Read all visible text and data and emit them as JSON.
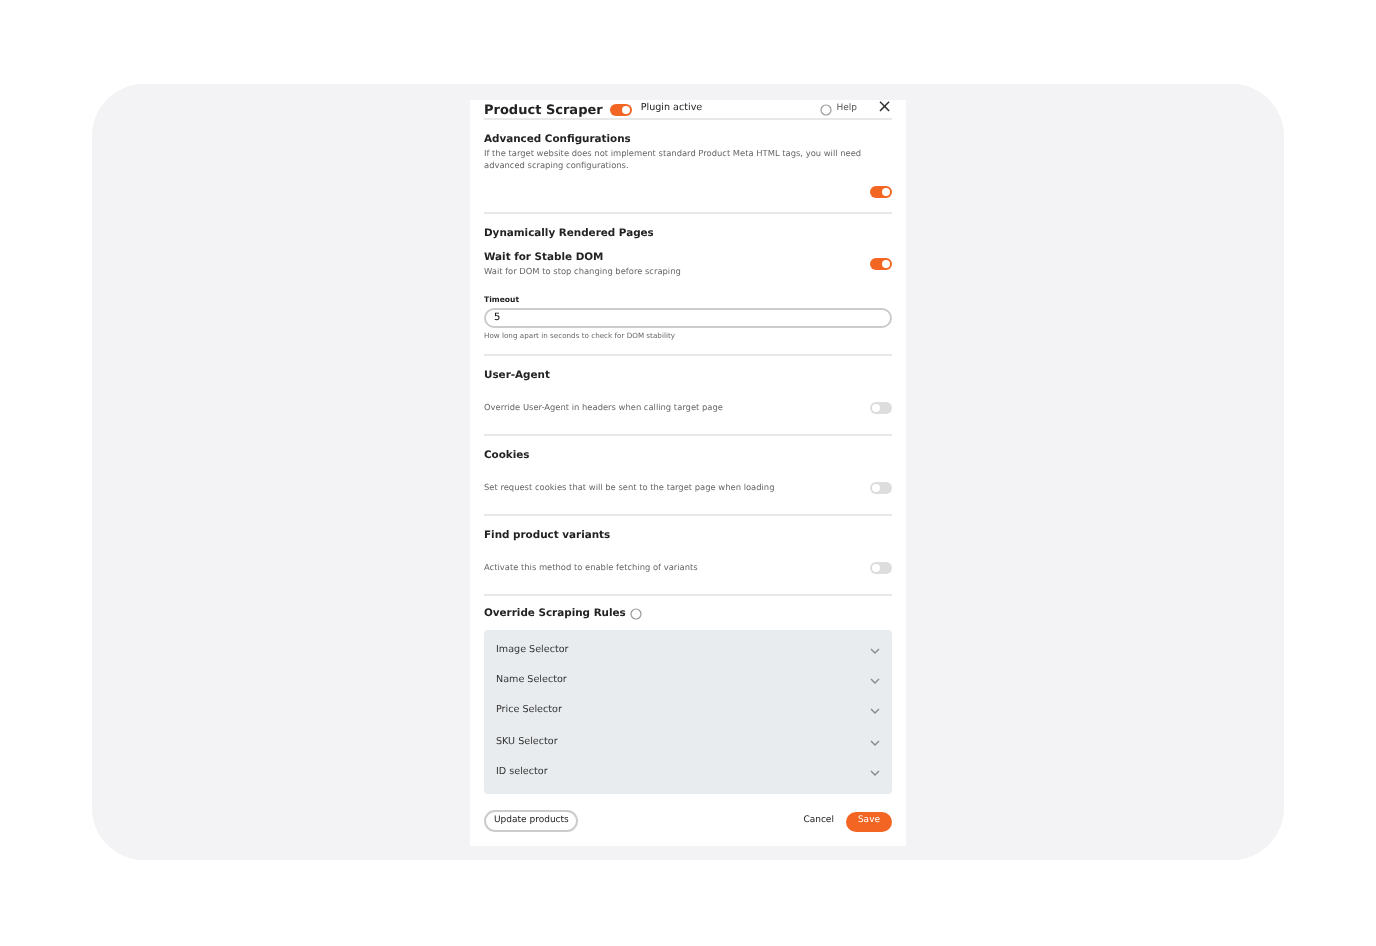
{
  "header": {
    "title": "Product Scraper",
    "plugin_toggle": {
      "on": true,
      "label": "Plugin active"
    },
    "help": "Help",
    "close": "×"
  },
  "advanced": {
    "title": "Advanced Configurations",
    "description": "If the target website does not implement standard Product Meta HTML tags, you will need advanced scraping configurations.",
    "on": true
  },
  "dynamic": {
    "heading": "Dynamically Rendered Pages",
    "wait": {
      "title": "Wait for Stable DOM",
      "description": "Wait for DOM to stop changing before scraping",
      "on": true
    },
    "timeout": {
      "label": "Timeout",
      "value": "5",
      "hint": "How long apart in seconds to check for DOM stability"
    }
  },
  "sections": [
    {
      "title": "User-Agent",
      "description": "Override User-Agent in headers when calling target page",
      "on": false
    },
    {
      "title": "Cookies",
      "description": "Set request cookies that will be sent to the target page when loading",
      "on": false
    },
    {
      "title": "Find product variants",
      "description": "Activate this method to enable fetching of variants",
      "on": false
    }
  ],
  "rules": {
    "title": "Override Scraping Rules",
    "selectors": [
      "Image Selector",
      "Name Selector",
      "Price Selector",
      "SKU Selector",
      "ID selector"
    ]
  },
  "footer": {
    "update": "Update products",
    "cancel": "Cancel",
    "save": "Save"
  }
}
